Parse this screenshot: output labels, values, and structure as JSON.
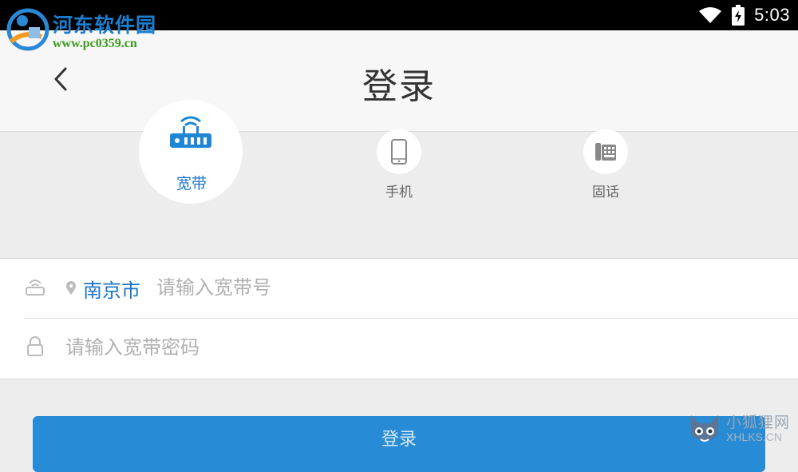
{
  "status_bar": {
    "time": "5:03",
    "wifi_icon": "wifi-icon",
    "battery_icon": "battery-icon"
  },
  "watermark": {
    "title": "河东软件园",
    "url": "www.pc0359.cn"
  },
  "header": {
    "title": "登录",
    "back_icon": "chevron-left-icon"
  },
  "login_types": {
    "broadband": {
      "label": "宽带",
      "icon": "router-icon",
      "selected": true
    },
    "mobile": {
      "label": "手机",
      "icon": "mobile-phone-icon"
    },
    "landline": {
      "label": "固话",
      "icon": "landline-phone-icon"
    }
  },
  "form": {
    "city": "南京市",
    "account_placeholder": "请输入宽带号",
    "password_placeholder": "请输入宽带密码"
  },
  "login_button": {
    "label": "登录"
  },
  "watermark2": {
    "cn": "小狐狸网",
    "en": "XHLKS.CN"
  },
  "colors": {
    "accent": "#1e86d4",
    "status_bar": "#000000",
    "background": "#ededed"
  }
}
